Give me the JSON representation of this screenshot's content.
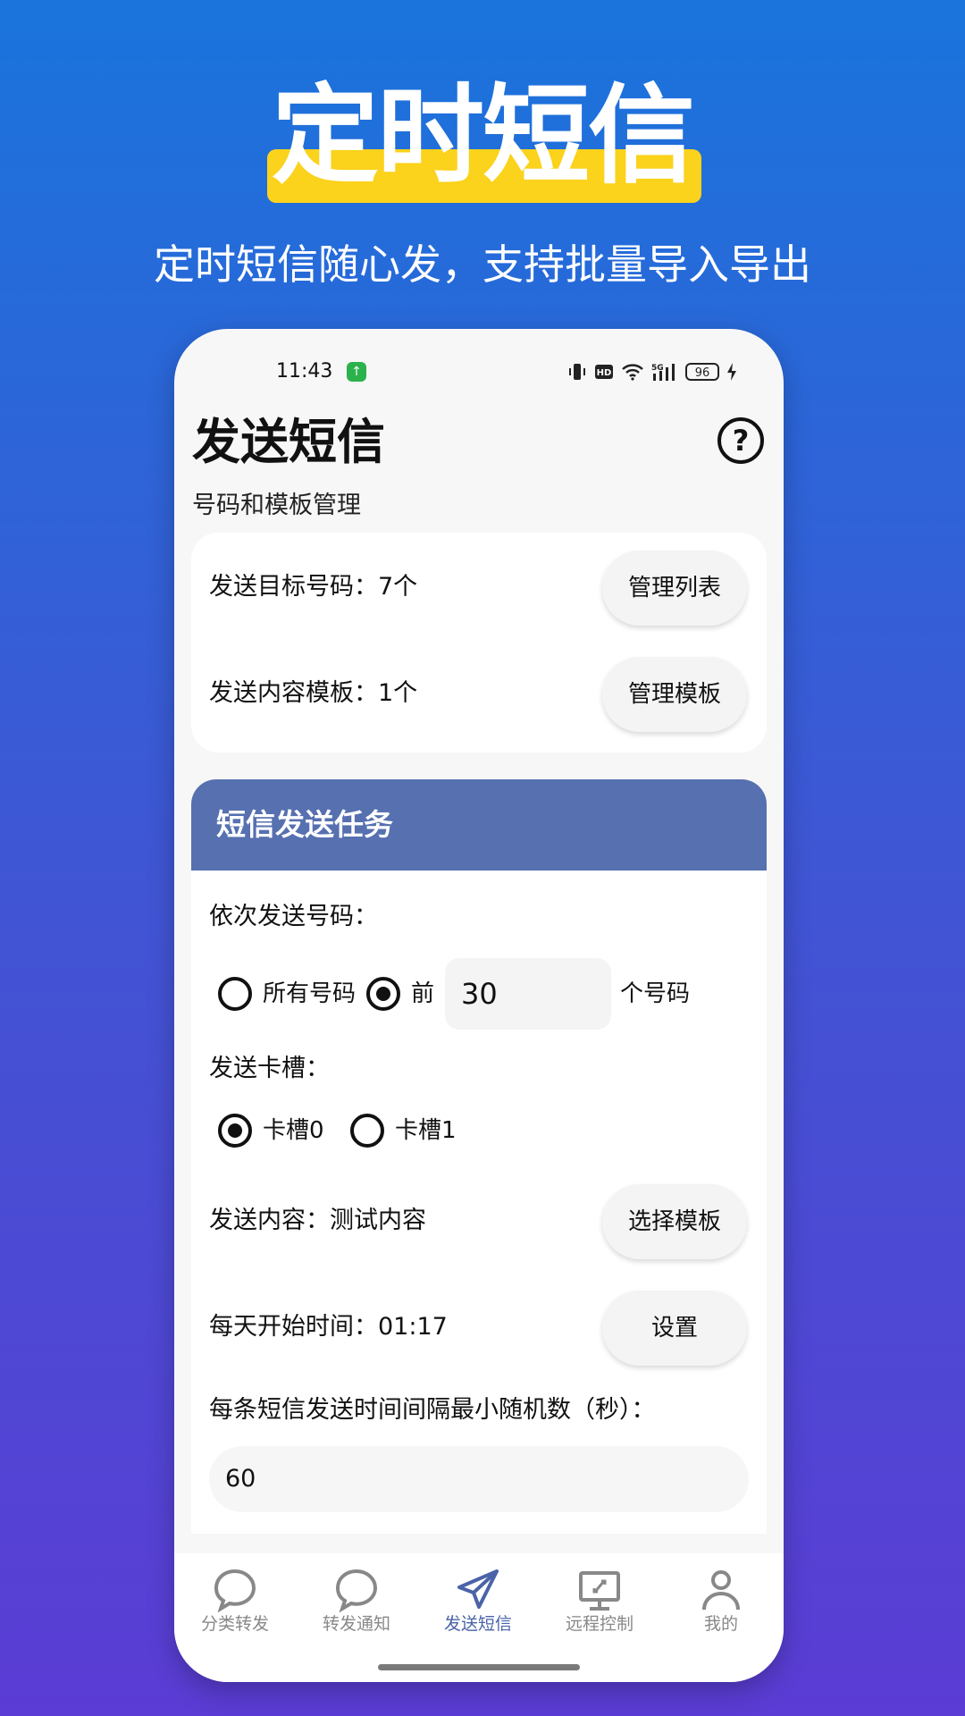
{
  "hero": {
    "title": "定时短信",
    "subtitle": "定时短信随心发，支持批量导入导出"
  },
  "status_bar": {
    "time": "11:43",
    "battery": "96"
  },
  "header": {
    "title": "发送短信",
    "help_icon_glyph": "?"
  },
  "manage_section": {
    "label": "号码和模板管理",
    "target_numbers": "发送目标号码：7个",
    "manage_list_button": "管理列表",
    "content_templates": "发送内容模板：1个",
    "manage_templates_button": "管理模板"
  },
  "task": {
    "title": "短信发送任务",
    "order_label": "依次发送号码：",
    "all_numbers_option": "所有号码",
    "first_option": "前",
    "first_count": "30",
    "numbers_suffix": "个号码",
    "slot_label": "发送卡槽：",
    "slot0": "卡槽0",
    "slot1": "卡槽1",
    "content_text": "发送内容：测试内容",
    "select_template_button": "选择模板",
    "start_time_text": "每天开始时间：01:17",
    "settings_button": "设置",
    "interval_label": "每条短信发送时间间隔最小随机数（秒）：",
    "interval_value": "60"
  },
  "bottom_nav": {
    "items": [
      {
        "label": "分类转发",
        "icon": "chat-bubble-icon"
      },
      {
        "label": "转发通知",
        "icon": "chat-bubble-icon"
      },
      {
        "label": "发送短信",
        "icon": "send-icon"
      },
      {
        "label": "远程控制",
        "icon": "remote-desktop-icon"
      },
      {
        "label": "我的",
        "icon": "person-icon"
      }
    ],
    "active_index": 2
  },
  "colors": {
    "accent": "#4a63a8",
    "header_bar": "#5670b0",
    "hero_highlight": "#fbd21c"
  }
}
